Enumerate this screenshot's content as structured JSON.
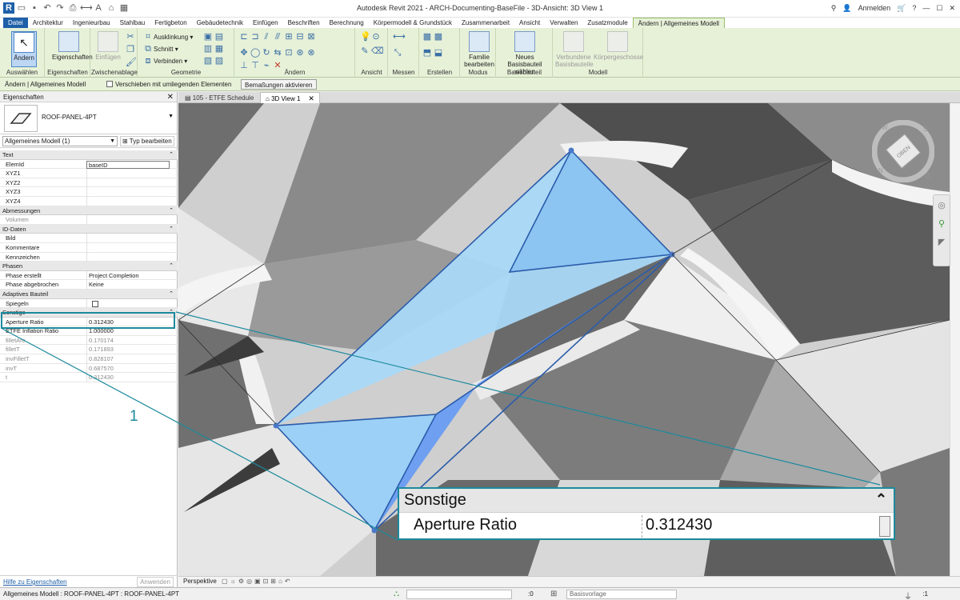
{
  "app": {
    "title": "Autodesk Revit 2021 - ARCH-Documenting-BaseFile - 3D-Ansicht: 3D View 1",
    "user_label": "Anmelden"
  },
  "ribbon": {
    "tabs": [
      "Datei",
      "Architektur",
      "Ingenieurbau",
      "Stahlbau",
      "Fertigbeton",
      "Gebäudetechnik",
      "Einfügen",
      "Beschriften",
      "Berechnung",
      "Körpermodell & Grundstück",
      "Zusammenarbeit",
      "Ansicht",
      "Verwalten",
      "Zusatzmodule",
      "Ändern | Allgemeines Modell"
    ],
    "active_tab": "Ändern | Allgemeines Modell",
    "panels": {
      "auswaehlen": "Auswählen",
      "eigenschaften": "Eigenschaften",
      "zwischenablage": "Zwischenablage",
      "geometrie": "Geometrie",
      "aendern": "Ändern",
      "ansicht": "Ansicht",
      "messen": "Messen",
      "erstellen": "Erstellen",
      "modus": "Modus",
      "basisbauteil": "Basisbauteil",
      "modell": "Modell"
    },
    "buttons": {
      "aendern": "Ändern",
      "eigenschaften": "Eigenschaften",
      "einfuegen": "Einfügen",
      "ausklinkung": "Ausklinkung",
      "schnitt": "Schnitt",
      "verbinden": "Verbinden",
      "familie_bearbeiten_1": "Familie",
      "familie_bearbeiten_2": "bearbeiten",
      "neues_basisbauteil_1": "Neues Basisbauteil",
      "neues_basisbauteil_2": "wählen",
      "verbundene_1": "Verbundene",
      "verbundene_2": "Basisbauteile",
      "koerpergeschosse": "Körpergeschosse"
    }
  },
  "optionbar": {
    "context": "Ändern | Allgemeines Modell",
    "checkbox": "Verschieben mit umliegenden Elementen",
    "button": "Bemaßungen aktivieren"
  },
  "properties": {
    "title": "Eigenschaften",
    "type_name": "ROOF-PANEL-4PT",
    "filter": "Allgemeines Modell (1)",
    "edit_type": "Typ bearbeiten",
    "help": "Hilfe zu Eigenschaften",
    "apply": "Anwenden",
    "rows": [
      {
        "cat": "Text"
      },
      {
        "k": "ElemId",
        "v": "baseID",
        "input": true
      },
      {
        "k": "XYZ1",
        "v": ""
      },
      {
        "k": "XYZ2",
        "v": ""
      },
      {
        "k": "XYZ3",
        "v": ""
      },
      {
        "k": "XYZ4",
        "v": ""
      },
      {
        "cat": "Abmessungen"
      },
      {
        "k": "Volumen",
        "v": "",
        "grey": true
      },
      {
        "cat": "ID-Daten"
      },
      {
        "k": "Bild",
        "v": ""
      },
      {
        "k": "Kommentare",
        "v": ""
      },
      {
        "k": "Kennzeichen",
        "v": ""
      },
      {
        "cat": "Phasen"
      },
      {
        "k": "Phase erstellt",
        "v": "Project Completion"
      },
      {
        "k": "Phase abgebrochen",
        "v": "Keine"
      },
      {
        "cat": "Adaptives Bauteil"
      },
      {
        "k": "Spiegeln",
        "v": "",
        "checkbox": true
      },
      {
        "cat": "Sonstige"
      },
      {
        "k": "Aperture Ratio",
        "v": "0.312430"
      },
      {
        "k": "ETFE Inflation Ratio",
        "v": "1.000000"
      },
      {
        "k": "filletArc",
        "v": "0.170174",
        "grey": true
      },
      {
        "k": "filletT",
        "v": "0.171893",
        "grey": true
      },
      {
        "k": "invFilletT",
        "v": "0.828107",
        "grey": true
      },
      {
        "k": "invT",
        "v": "0.687570",
        "grey": true
      },
      {
        "k": "t",
        "v": "0.312430",
        "grey": true
      }
    ]
  },
  "view_tabs": [
    {
      "label": "105 - ETFE Schedule",
      "active": false
    },
    {
      "label": "3D View 1",
      "active": true
    }
  ],
  "viewbar": {
    "label": "Perspektive"
  },
  "callout": {
    "number": "1",
    "category": "Sonstige",
    "key": "Aperture Ratio",
    "value": "0.312430"
  },
  "navwheel": {
    "label": "OBEN",
    "compass": [
      "S",
      "O",
      "N",
      "W"
    ]
  },
  "statusbar": {
    "selection": "Allgemeines Modell : ROOF-PANEL-4PT : ROOF-PANEL-4PT",
    "count": ":0",
    "model": "Basisvorlage",
    "filter_count": ":1"
  },
  "colors": {
    "accent": "#1b8a9d",
    "ribbon": "#e7f1d8",
    "selection_fill": "#9fd0f5",
    "file_tab": "#1e5fa8"
  }
}
